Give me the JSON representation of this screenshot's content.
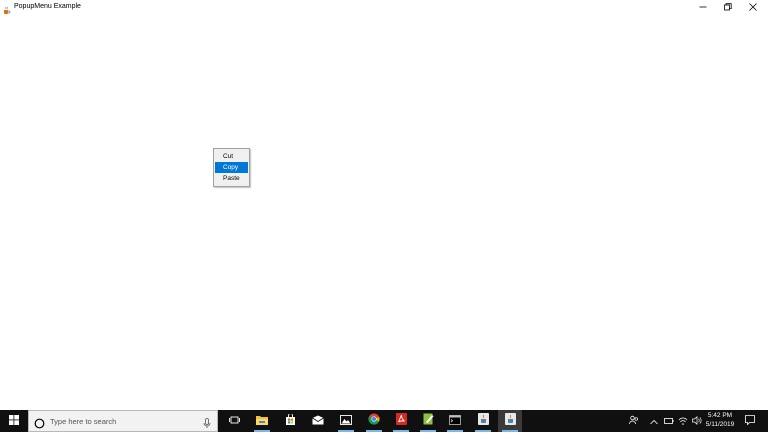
{
  "window": {
    "title": "PopupMenu Example",
    "app_icon": "java-cup-icon",
    "controls": {
      "minimize_icon": "minimize-icon",
      "restore_icon": "restore-icon",
      "close_icon": "close-icon"
    }
  },
  "popup_menu": {
    "items": [
      {
        "label": "Cut",
        "selected": false
      },
      {
        "label": "Copy",
        "selected": true
      },
      {
        "label": "Paste",
        "selected": false
      }
    ],
    "selection_color": "#0078d7"
  },
  "taskbar": {
    "background": "#101010",
    "search": {
      "placeholder": "Type here to search",
      "search_icon": "cortana-circle-icon",
      "mic_icon": "microphone-icon"
    },
    "apps": [
      {
        "name": "task-view-icon"
      },
      {
        "name": "file-explorer-icon"
      },
      {
        "name": "store-icon"
      },
      {
        "name": "mail-icon"
      },
      {
        "name": "photos-icon"
      },
      {
        "name": "chrome-icon"
      },
      {
        "name": "acrobat-icon"
      },
      {
        "name": "notepad-plus-icon"
      },
      {
        "name": "terminal-icon"
      },
      {
        "name": "java-icon"
      },
      {
        "name": "java-active-icon"
      }
    ],
    "tray": {
      "time": "5:42 PM",
      "date": "5/11/2019",
      "icons": [
        "people-icon",
        "chevron-up-icon",
        "battery-icon",
        "network-icon",
        "volume-icon"
      ],
      "notification_icon": "action-center-icon"
    }
  }
}
